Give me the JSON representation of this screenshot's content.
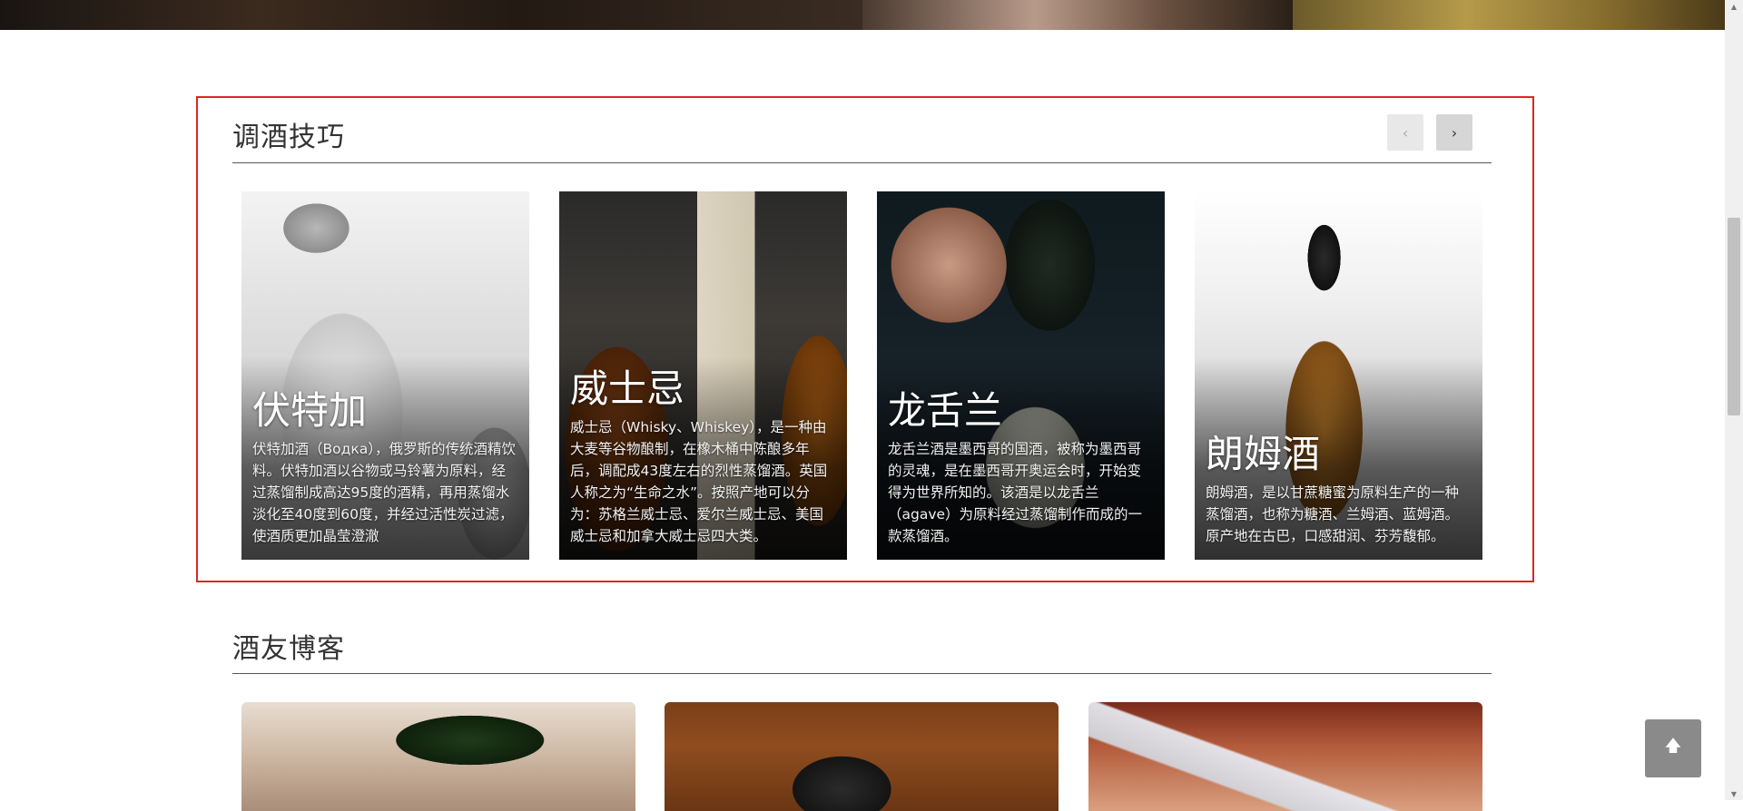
{
  "section_techniques": {
    "title": "调酒技巧",
    "prev_icon": "‹",
    "next_icon": "›",
    "cards": [
      {
        "name": "伏特加",
        "desc": "伏特加酒（Водка），俄罗斯的传统酒精饮料。伏特加酒以谷物或马铃薯为原料，经过蒸馏制成高达95度的酒精，再用蒸馏水淡化至40度到60度，并经过活性炭过滤，使酒质更加晶莹澄澈"
      },
      {
        "name": "威士忌",
        "desc": "威士忌（Whisky、Whiskey），是一种由大麦等谷物酿制，在橡木桶中陈酿多年后，调配成43度左右的烈性蒸馏酒。英国人称之为“生命之水”。按照产地可以分为：苏格兰威士忌、爱尔兰威士忌、美国威士忌和加拿大威士忌四大类。"
      },
      {
        "name": "龙舌兰",
        "desc": "龙舌兰酒是墨西哥的国酒，被称为墨西哥的灵魂，是在墨西哥开奥运会时，开始变得为世界所知的。该酒是以龙舌兰（agave）为原料经过蒸馏制作而成的一款蒸馏酒。"
      },
      {
        "name": "朗姆酒",
        "desc": "朗姆酒，是以甘蔗糖蜜为原料生产的一种蒸馏酒，也称为糖酒、兰姆酒、蓝姆酒。原产地在古巴，口感甜润、芬芳馥郁。"
      }
    ]
  },
  "section_blog": {
    "title": "酒友博客"
  },
  "back_to_top": {
    "icon": "arrow-up-icon"
  },
  "scrollbar": {
    "up_icon": "▲",
    "down_icon": "▼"
  }
}
